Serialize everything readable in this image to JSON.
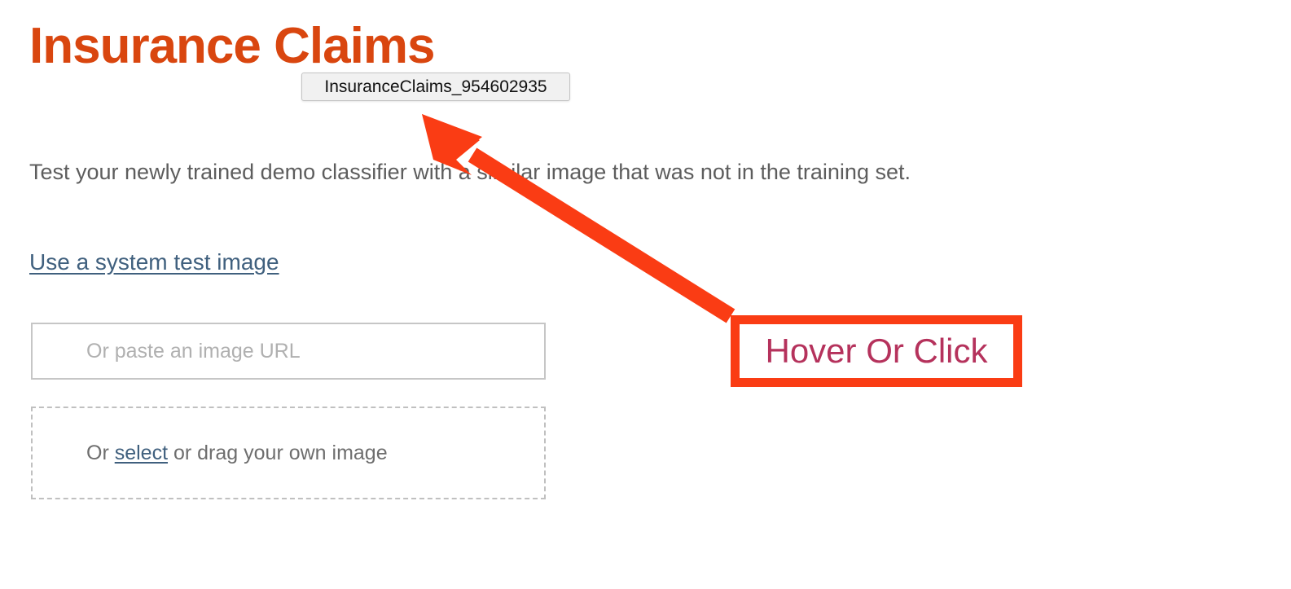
{
  "page": {
    "title": "Insurance Claims",
    "title_color": "#d9460f",
    "description": "Test your newly trained demo classifier with a similar image that was not in the training set."
  },
  "tooltip": {
    "text": "InsuranceClaims_954602935",
    "background_color": "#f1f1f1",
    "border_color": "#c4c4c4"
  },
  "links": {
    "system_test_image": "Use a system test image",
    "link_color": "#40607e"
  },
  "url_field": {
    "value": "",
    "placeholder": "Or paste an image URL",
    "border_color": "#c6c6c6"
  },
  "dropzone": {
    "prefix": "Or ",
    "link_label": "select",
    "suffix": " or drag your own image",
    "border_color": "#c0c0c0"
  },
  "annotation": {
    "callout_label": "Hover Or Click",
    "callout_text_color": "#b5325c",
    "callout_border_color": "#fa3c14",
    "arrow_color": "#fa3c14",
    "arrow_tip": "518,140",
    "arrow_tail": "897,388"
  }
}
